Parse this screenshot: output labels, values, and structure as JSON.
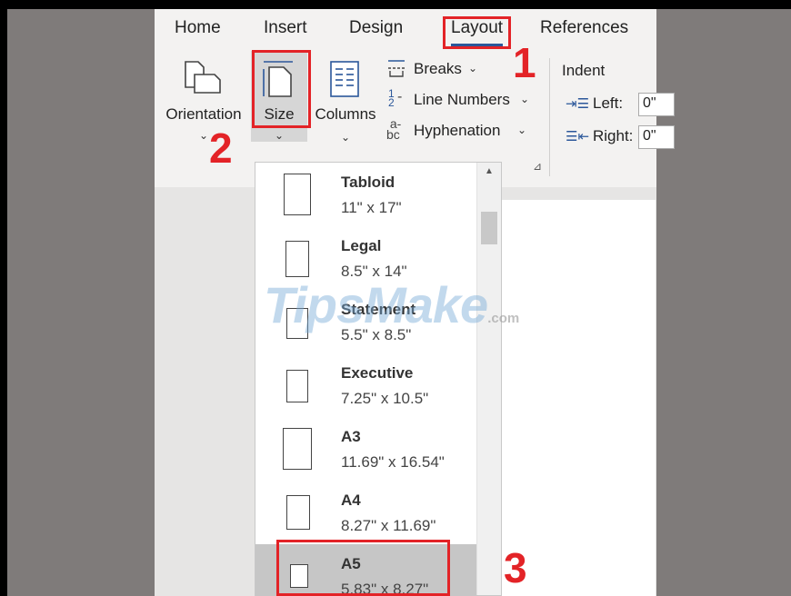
{
  "ribbon": {
    "tabs": [
      {
        "label": "Home"
      },
      {
        "label": "Insert"
      },
      {
        "label": "Design"
      },
      {
        "label": "Layout"
      },
      {
        "label": "References"
      }
    ],
    "orientation_label": "Orientation",
    "size_label": "Size",
    "columns_label": "Columns",
    "breaks_label": "Breaks",
    "line_numbers_label": "Line Numbers",
    "hyphenation_label": "Hyphenation",
    "indent_label": "Indent",
    "left_label": "Left:",
    "right_label": "Right:",
    "left_value": "0\"",
    "right_value": "0\""
  },
  "steps": [
    "1",
    "2",
    "3"
  ],
  "paper_sizes": [
    {
      "name": "Tabloid",
      "size": "11\" x 17\""
    },
    {
      "name": "Legal",
      "size": "8.5\" x 14\""
    },
    {
      "name": "Statement",
      "size": "5.5\" x 8.5\""
    },
    {
      "name": "Executive",
      "size": "7.25\" x 10.5\""
    },
    {
      "name": "A3",
      "size": "11.69\" x 16.54\""
    },
    {
      "name": "A4",
      "size": "8.27\" x 11.69\""
    },
    {
      "name": "A5",
      "size": "5.83\" x 8.27\""
    }
  ],
  "selected_paper": "A5",
  "watermark": {
    "main": "TipsMake",
    "suffix": ".com"
  },
  "colors": {
    "accent": "#2b579a",
    "highlight_red": "#e32327",
    "selected_bg": "#c6c6c6"
  }
}
